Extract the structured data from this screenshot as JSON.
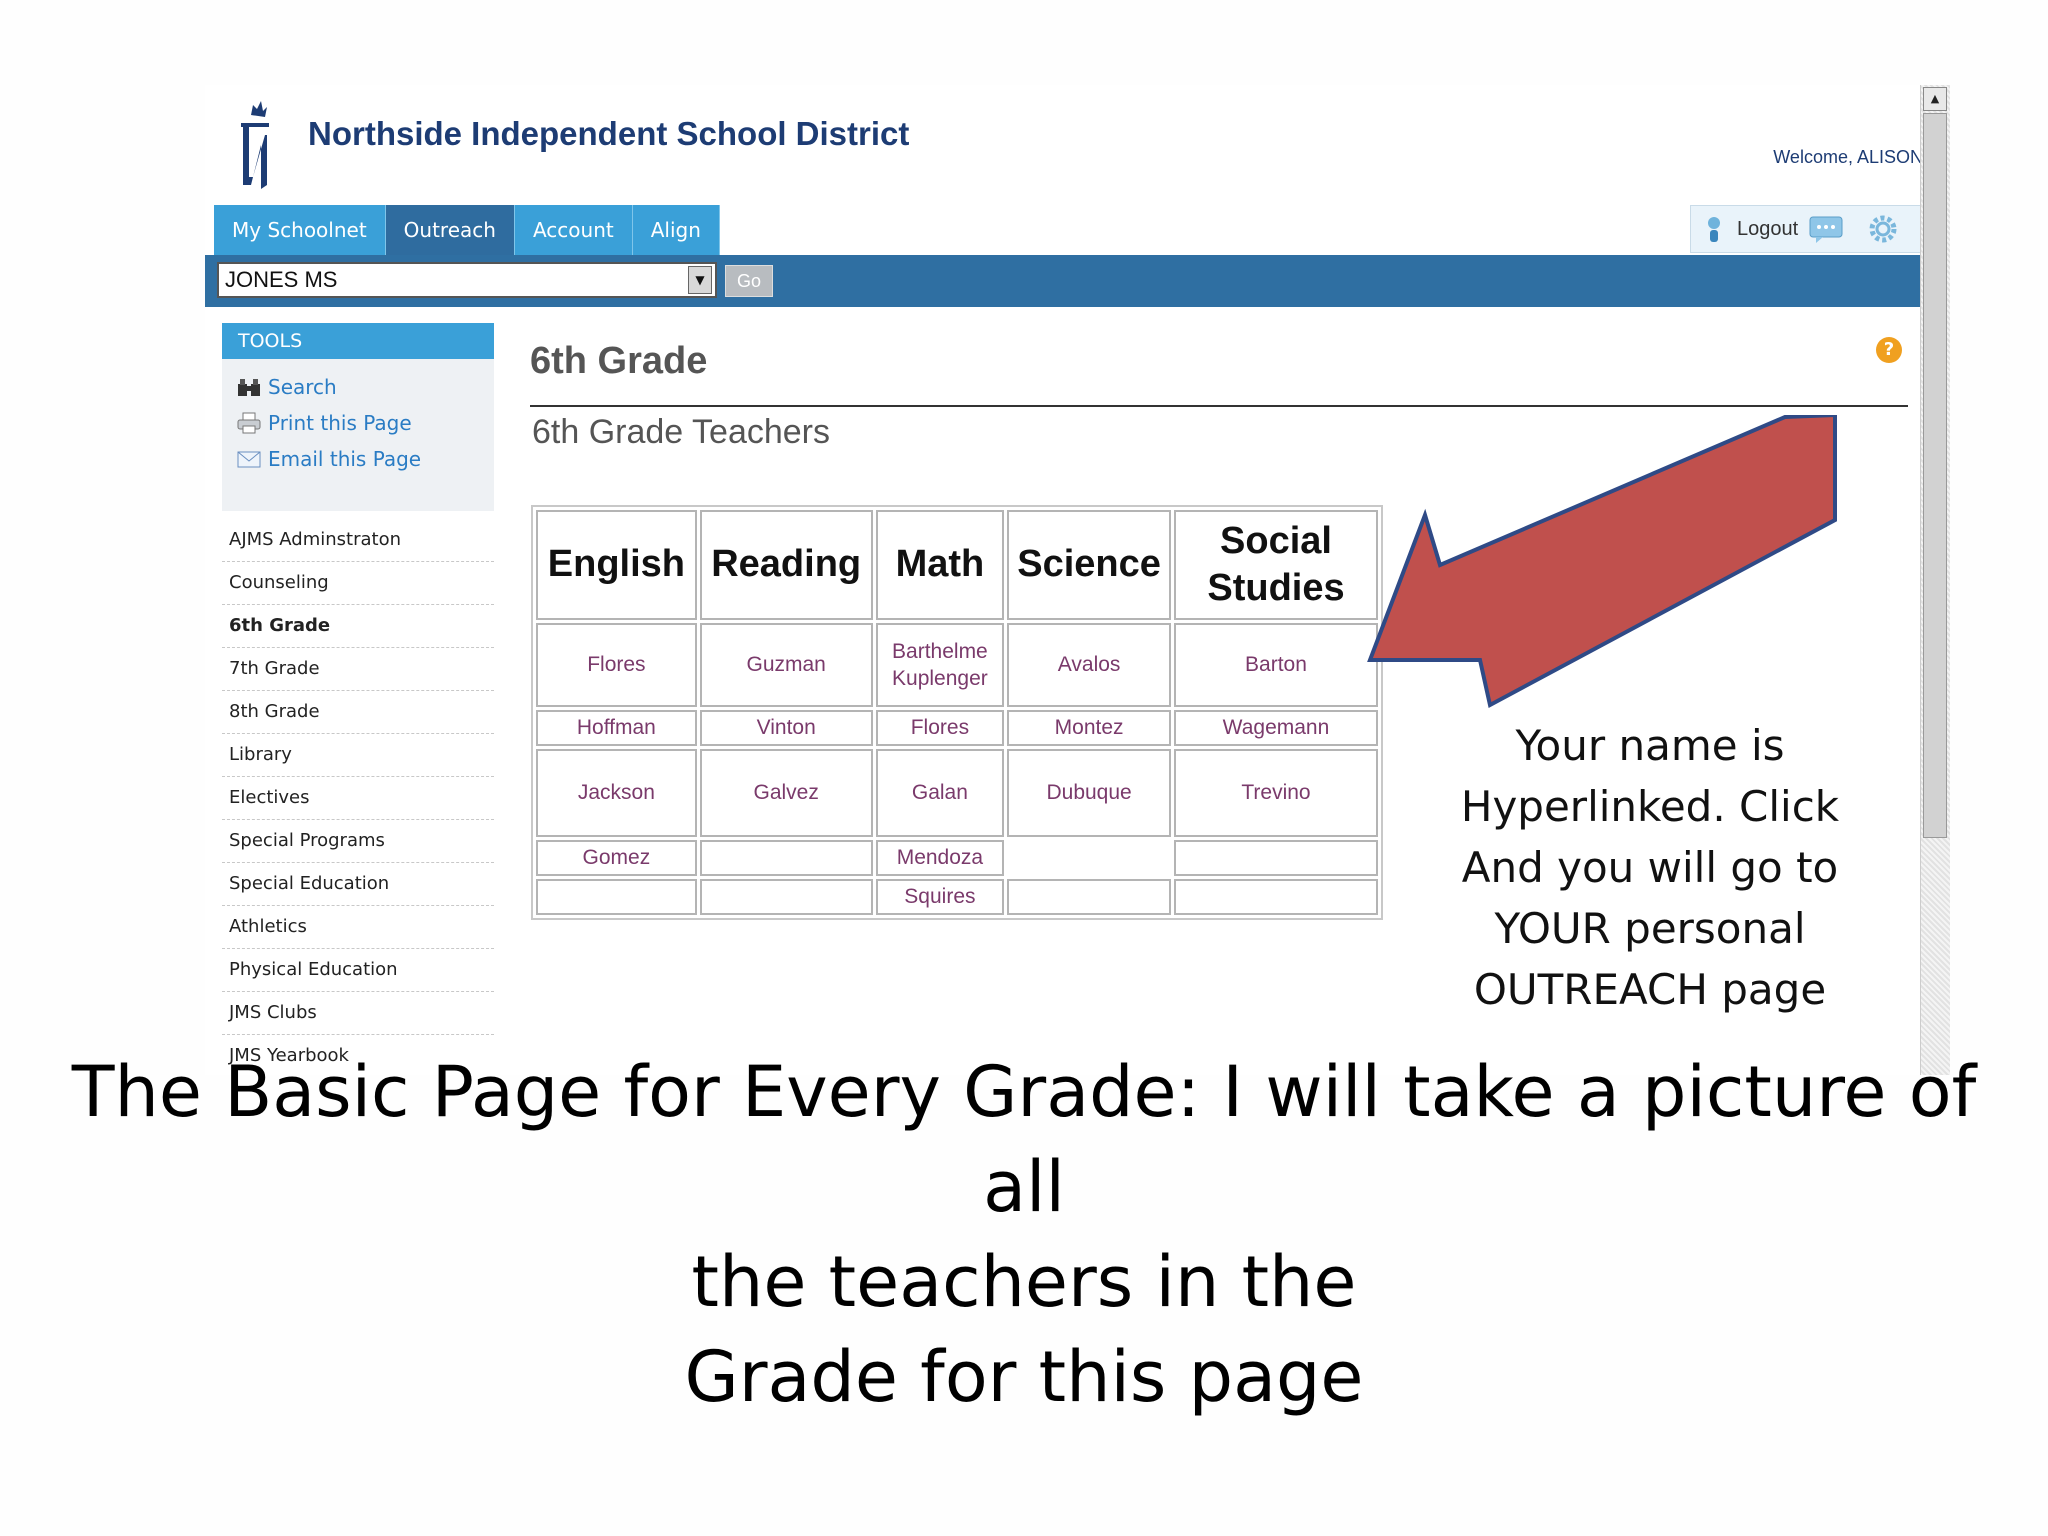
{
  "header": {
    "district_name": "Northside Independent School District",
    "welcome": "Welcome, ALISON!"
  },
  "tabs": [
    {
      "label": "My Schoolnet",
      "active": false
    },
    {
      "label": "Outreach",
      "active": true
    },
    {
      "label": "Account",
      "active": false
    },
    {
      "label": "Align",
      "active": false
    }
  ],
  "utility": {
    "logout_label": "Logout"
  },
  "toolbar": {
    "school_value": "JONES MS",
    "go_label": "Go"
  },
  "sidebar": {
    "tools_header": "TOOLS",
    "tools": [
      {
        "label": "Search",
        "icon": "binoculars-icon"
      },
      {
        "label": "Print this Page",
        "icon": "printer-icon"
      },
      {
        "label": "Email this Page",
        "icon": "envelope-icon"
      }
    ],
    "items": [
      "AJMS Adminstraton",
      "Counseling",
      "6th Grade",
      "7th Grade",
      "8th Grade",
      "Library",
      "Electives",
      "Special Programs",
      "Special Education",
      "Athletics",
      "Physical Education",
      "JMS Clubs",
      "JMS Yearbook"
    ],
    "current_item": "6th Grade"
  },
  "main": {
    "title": "6th Grade",
    "subtitle": "6th Grade Teachers",
    "help_symbol": "?",
    "table": {
      "headers": [
        "English",
        "Reading",
        "Math",
        "Science",
        "Social Studies"
      ],
      "rows": [
        [
          "Flores",
          "Guzman",
          "Barthelme Kuplenger",
          "Avalos",
          "Barton"
        ],
        [
          "Hoffman",
          "Vinton",
          "Flores",
          "Montez",
          "Wagemann"
        ],
        [
          "Jackson",
          "Galvez",
          "Galan",
          "Dubuque",
          "Trevino"
        ],
        [
          "Gomez",
          "",
          "Mendoza",
          "",
          ""
        ],
        [
          "",
          "",
          "Squires",
          "",
          ""
        ]
      ]
    }
  },
  "annotation": {
    "callout_lines": [
      "Your name is",
      "Hyperlinked. Click",
      "And you will go to",
      "YOUR personal",
      "OUTREACH page"
    ],
    "arrow_color": "#c0504d",
    "arrow_outline": "#2f4a86"
  },
  "caption": {
    "lines": [
      "The Basic Page for Every Grade: I will take a picture of all",
      "the teachers in the",
      "Grade for this page"
    ]
  },
  "colors": {
    "tab_blue": "#3aa0d8",
    "tab_active": "#2f6c9f",
    "bar_blue": "#2f6fa2",
    "district_navy": "#1d3c74",
    "teacher_link": "#7a3a6b"
  }
}
